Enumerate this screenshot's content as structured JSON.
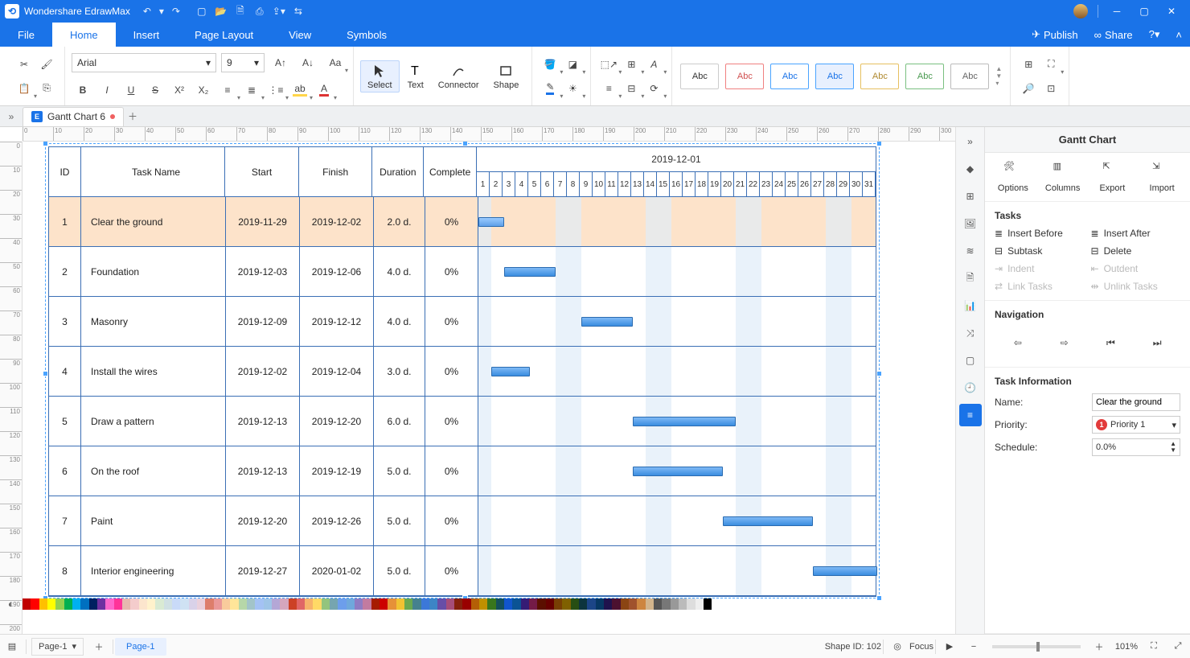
{
  "app_title": "Wondershare EdrawMax",
  "menu": {
    "file": "File",
    "home": "Home",
    "insert": "Insert",
    "page": "Page Layout",
    "view": "View",
    "symbols": "Symbols",
    "publish": "Publish",
    "share": "Share"
  },
  "font": {
    "name": "Arial",
    "size": "9"
  },
  "ribbon_tools": {
    "select": "Select",
    "text": "Text",
    "connector": "Connector",
    "shape": "Shape"
  },
  "style_label": "Abc",
  "doc_tab": "Gantt Chart 6",
  "timeline_month": "2019-12-01",
  "headers": {
    "id": "ID",
    "task": "Task Name",
    "start": "Start",
    "finish": "Finish",
    "dur": "Duration",
    "comp": "Complete"
  },
  "tasks": [
    {
      "id": "1",
      "name": "Clear the ground",
      "start": "2019-11-29",
      "finish": "2019-12-02",
      "dur": "2.0 d.",
      "comp": "0%",
      "bar_from": 1,
      "bar_len": 2,
      "active": true
    },
    {
      "id": "2",
      "name": "Foundation",
      "start": "2019-12-03",
      "finish": "2019-12-06",
      "dur": "4.0 d.",
      "comp": "0%",
      "bar_from": 3,
      "bar_len": 4
    },
    {
      "id": "3",
      "name": "Masonry",
      "start": "2019-12-09",
      "finish": "2019-12-12",
      "dur": "4.0 d.",
      "comp": "0%",
      "bar_from": 9,
      "bar_len": 4
    },
    {
      "id": "4",
      "name": "Install the wires",
      "start": "2019-12-02",
      "finish": "2019-12-04",
      "dur": "3.0 d.",
      "comp": "0%",
      "bar_from": 2,
      "bar_len": 3
    },
    {
      "id": "5",
      "name": "Draw a pattern",
      "start": "2019-12-13",
      "finish": "2019-12-20",
      "dur": "6.0 d.",
      "comp": "0%",
      "bar_from": 13,
      "bar_len": 8
    },
    {
      "id": "6",
      "name": "On the roof",
      "start": "2019-12-13",
      "finish": "2019-12-19",
      "dur": "5.0 d.",
      "comp": "0%",
      "bar_from": 13,
      "bar_len": 7
    },
    {
      "id": "7",
      "name": "Paint",
      "start": "2019-12-20",
      "finish": "2019-12-26",
      "dur": "5.0 d.",
      "comp": "0%",
      "bar_from": 20,
      "bar_len": 7
    },
    {
      "id": "8",
      "name": "Interior engineering",
      "start": "2019-12-27",
      "finish": "2020-01-02",
      "dur": "5.0 d.",
      "comp": "0%",
      "bar_from": 27,
      "bar_len": 5
    }
  ],
  "day_count": 31,
  "weekends": [
    1,
    7,
    8,
    14,
    15,
    21,
    22,
    28,
    29
  ],
  "rpanel": {
    "title": "Gantt Chart",
    "big": {
      "options": "Options",
      "columns": "Columns",
      "export": "Export",
      "import": "Import"
    },
    "tasks_h": "Tasks",
    "btns": {
      "ib": "Insert Before",
      "ia": "Insert After",
      "sub": "Subtask",
      "del": "Delete",
      "ind": "Indent",
      "out": "Outdent",
      "link": "Link Tasks",
      "unlink": "Unlink Tasks"
    },
    "nav_h": "Navigation",
    "ti_h": "Task Information",
    "name_l": "Name:",
    "name_v": "Clear the ground",
    "prio_l": "Priority:",
    "prio_v": "Priority 1",
    "sched_l": "Schedule:",
    "sched_v": "0.0%"
  },
  "status": {
    "page_sel": "Page-1",
    "page_active": "Page-1",
    "shape_id": "Shape ID: 102",
    "focus": "Focus",
    "zoom": "101%"
  },
  "colors": [
    "#c00000",
    "#ff0000",
    "#ffc000",
    "#ffff00",
    "#92d050",
    "#00b050",
    "#00b0f0",
    "#0070c0",
    "#002060",
    "#7030a0",
    "#ff66cc",
    "#ff3399",
    "#e6b8af",
    "#f4cccc",
    "#fce5cd",
    "#fff2cc",
    "#d9ead3",
    "#d0e0e3",
    "#c9daf8",
    "#cfe2f3",
    "#d9d2e9",
    "#ead1dc",
    "#dd7e6b",
    "#ea9999",
    "#f9cb9c",
    "#ffe599",
    "#b6d7a8",
    "#a2c4c9",
    "#a4c2f4",
    "#9fc5e8",
    "#b4a7d6",
    "#d5a6bd",
    "#cc4125",
    "#e06666",
    "#f6b26b",
    "#ffd966",
    "#93c47d",
    "#76a5af",
    "#6d9eeb",
    "#6fa8dc",
    "#8e7cc3",
    "#c27ba0",
    "#a61c00",
    "#cc0000",
    "#e69138",
    "#f1c232",
    "#6aa84f",
    "#45818e",
    "#3c78d8",
    "#3d85c6",
    "#674ea7",
    "#a64d79",
    "#85200c",
    "#990000",
    "#b45f06",
    "#bf9000",
    "#38761d",
    "#134f5c",
    "#1155cc",
    "#0b5394",
    "#351c75",
    "#741b47",
    "#5b0f00",
    "#660000",
    "#783f04",
    "#7f6000",
    "#274e13",
    "#0c343d",
    "#1c4587",
    "#073763",
    "#20124d",
    "#4c1130",
    "#8b4513",
    "#a0522d",
    "#cd853f",
    "#d2b48c",
    "#555555",
    "#777777",
    "#999999",
    "#bbbbbb",
    "#dddddd",
    "#eeeeee",
    "#000000",
    "#ffffff"
  ]
}
